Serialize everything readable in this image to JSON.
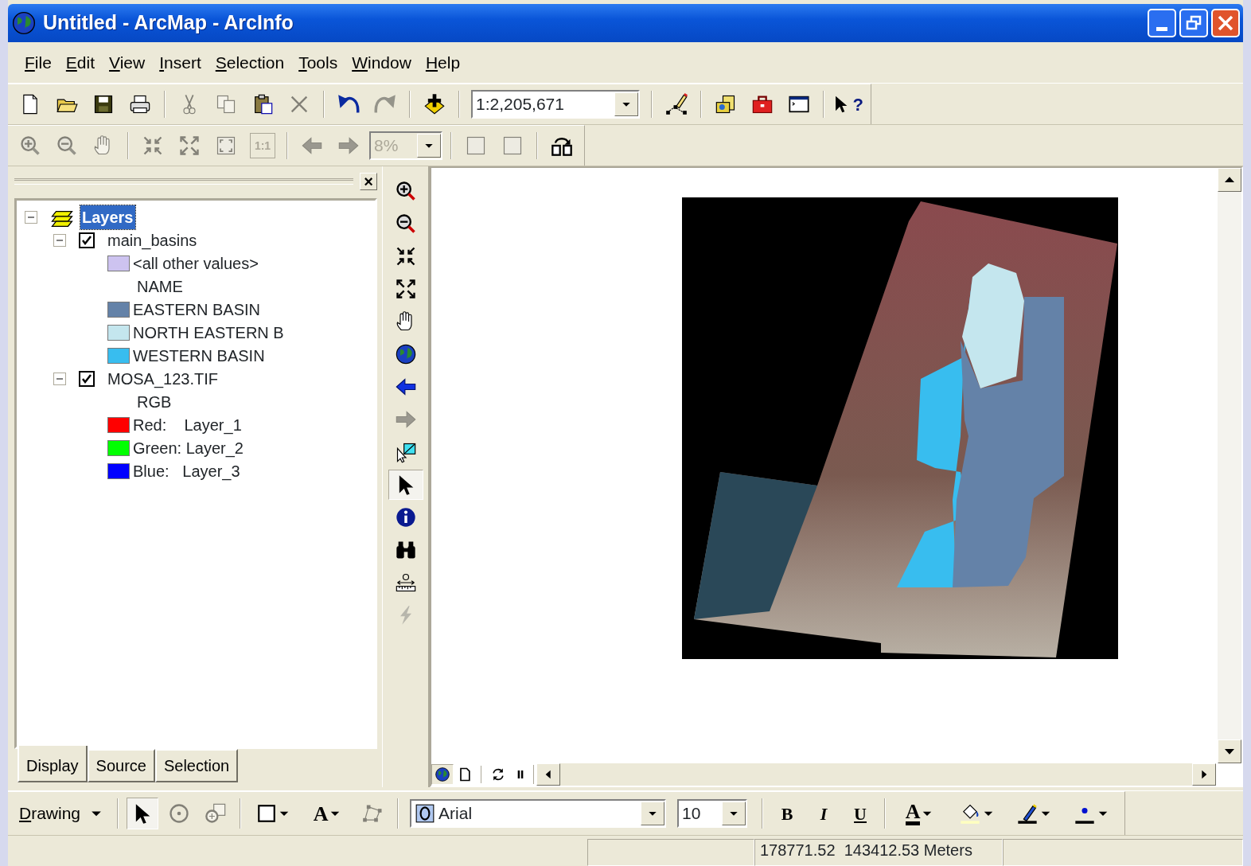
{
  "window": {
    "title": "Untitled - ArcMap - ArcInfo"
  },
  "menu": [
    {
      "label": "File"
    },
    {
      "label": "Edit"
    },
    {
      "label": "View"
    },
    {
      "label": "Insert"
    },
    {
      "label": "Selection"
    },
    {
      "label": "Tools"
    },
    {
      "label": "Window"
    },
    {
      "label": "Help"
    }
  ],
  "standard_toolbar": [
    {
      "kind": "button",
      "disabled": false
    },
    {
      "kind": "button",
      "disabled": false
    },
    {
      "kind": "button",
      "disabled": false
    },
    {
      "kind": "button",
      "disabled": false
    },
    {
      "kind": "button",
      "disabled": true
    },
    {
      "kind": "button",
      "disabled": true
    },
    {
      "kind": "button",
      "disabled": false
    },
    {
      "kind": "button",
      "disabled": true
    },
    {
      "kind": "button",
      "disabled": false
    },
    {
      "kind": "button",
      "disabled": true
    },
    {
      "kind": "button",
      "disabled": false
    },
    {
      "kind": "combo",
      "value": "1:2,205,671",
      "disabled": false
    },
    {
      "kind": "button",
      "disabled": false
    },
    {
      "kind": "button",
      "disabled": false
    },
    {
      "kind": "button",
      "disabled": false
    },
    {
      "kind": "button",
      "disabled": false
    },
    {
      "kind": "button",
      "label": "?",
      "disabled": false
    }
  ],
  "layout_toolbar": [
    {
      "kind": "button",
      "disabled": true
    },
    {
      "kind": "button",
      "disabled": true
    },
    {
      "kind": "button",
      "disabled": true
    },
    {
      "kind": "button",
      "disabled": true
    },
    {
      "kind": "button",
      "disabled": true
    },
    {
      "kind": "button",
      "disabled": true
    },
    {
      "kind": "button",
      "label": "1:1",
      "disabled": true
    },
    {
      "kind": "button",
      "disabled": true
    },
    {
      "kind": "button",
      "disabled": true
    },
    {
      "kind": "combo",
      "value": "8%",
      "disabled": true
    },
    {
      "kind": "button",
      "disabled": true
    },
    {
      "kind": "button",
      "disabled": true
    },
    {
      "kind": "button",
      "disabled": false
    }
  ],
  "toc": {
    "close": "×",
    "root": {
      "label": "Layers",
      "selected": true,
      "expanded": true,
      "children": [
        {
          "label": "main_basins",
          "checked": true,
          "expanded": true,
          "legend": [
            {
              "kind": "swatch",
              "label": "<all other values>",
              "color": "#cdc3f0"
            },
            {
              "kind": "heading",
              "label": "NAME"
            },
            {
              "kind": "swatch",
              "label": "EASTERN BASIN",
              "color": "#6482a8"
            },
            {
              "kind": "swatch",
              "label": "NORTH EASTERN B",
              "color": "#c4e6ee"
            },
            {
              "kind": "swatch",
              "label": "WESTERN BASIN",
              "color": "#38bdef"
            }
          ]
        },
        {
          "label": "MOSA_123.TIF",
          "checked": true,
          "expanded": true,
          "legend": [
            {
              "kind": "heading",
              "label": "RGB"
            },
            {
              "kind": "swatch",
              "label": "Red:    Layer_1",
              "color": "#ff0000"
            },
            {
              "kind": "swatch",
              "label": "Green: Layer_2",
              "color": "#00ff00"
            },
            {
              "kind": "swatch",
              "label": "Blue:   Layer_3",
              "color": "#0000ff"
            }
          ]
        }
      ]
    },
    "tabs": [
      {
        "label": "Display",
        "selected": true
      },
      {
        "label": "Source",
        "selected": false
      },
      {
        "label": "Selection",
        "selected": false
      }
    ]
  },
  "tools": [
    {
      "selected": false,
      "disabled": false
    },
    {
      "selected": false,
      "disabled": false
    },
    {
      "selected": false,
      "disabled": false
    },
    {
      "selected": false,
      "disabled": false
    },
    {
      "selected": false,
      "disabled": false
    },
    {
      "selected": false,
      "disabled": false
    },
    {
      "selected": false,
      "disabled": false
    },
    {
      "selected": false,
      "disabled": true
    },
    {
      "selected": false,
      "disabled": false
    },
    {
      "selected": true,
      "disabled": false
    },
    {
      "selected": false,
      "disabled": false
    },
    {
      "selected": false,
      "disabled": false
    },
    {
      "selected": false,
      "disabled": false
    },
    {
      "selected": false,
      "disabled": true
    }
  ],
  "map_controls": [
    {
      "kind": "view",
      "selected": true
    },
    {
      "kind": "view",
      "selected": false
    },
    {
      "kind": "action"
    },
    {
      "kind": "action"
    }
  ],
  "drawing_toolbar": [
    {
      "kind": "menu",
      "label": "Drawing",
      "selected": false,
      "disabled": false
    },
    {
      "kind": "button",
      "selected": true,
      "disabled": false
    },
    {
      "kind": "button",
      "selected": false,
      "disabled": true
    },
    {
      "kind": "button",
      "selected": false,
      "disabled": true
    },
    {
      "kind": "split",
      "selected": false,
      "disabled": false
    },
    {
      "kind": "split",
      "label": "A",
      "selected": false,
      "disabled": false
    },
    {
      "kind": "button",
      "selected": false,
      "disabled": true
    },
    {
      "kind": "combo",
      "value": "Arial",
      "selected": false,
      "disabled": false
    },
    {
      "kind": "combo",
      "value": "10",
      "selected": false,
      "disabled": false
    },
    {
      "kind": "button",
      "label": "B",
      "selected": false,
      "disabled": false
    },
    {
      "kind": "button",
      "label": "I",
      "selected": false,
      "disabled": false
    },
    {
      "kind": "button",
      "label": "U",
      "selected": false,
      "disabled": false
    },
    {
      "kind": "split",
      "label": "A",
      "selected": false,
      "disabled": false
    },
    {
      "kind": "split",
      "selected": false,
      "disabled": false
    },
    {
      "kind": "split",
      "selected": false,
      "disabled": false
    },
    {
      "kind": "split",
      "selected": false,
      "disabled": false
    }
  ],
  "status_bar": {
    "coordinates": "178771.52  143412.53 Meters"
  }
}
